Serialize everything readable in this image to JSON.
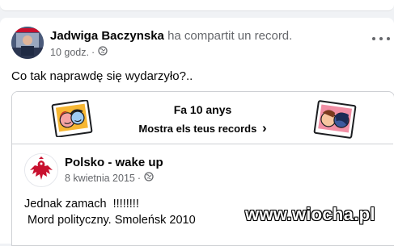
{
  "post": {
    "author": "Jadwiga Baczynska",
    "action": "ha compartit un record.",
    "time": "10 godz.",
    "separator": "·",
    "privacy_icon": "globe-icon",
    "caption": "Co tak naprawdę się wydarzyło?.."
  },
  "memory": {
    "title": "Fa 10 anys",
    "link": "Mostra els teus records",
    "chevron": "›"
  },
  "shared": {
    "page_name": "Polsko - wake up",
    "date": "8 kwietnia 2015",
    "separator": "·",
    "privacy_icon": "globe-icon",
    "line1": "Jednak zamach  !!!!!!!!",
    "line2": " Mord polityczny. Smoleńsk 2010"
  },
  "watermark": "www.wiocha.pl",
  "colors": {
    "secondary_text": "#65676b",
    "background": "#f0f2f5",
    "card": "#ffffff"
  }
}
